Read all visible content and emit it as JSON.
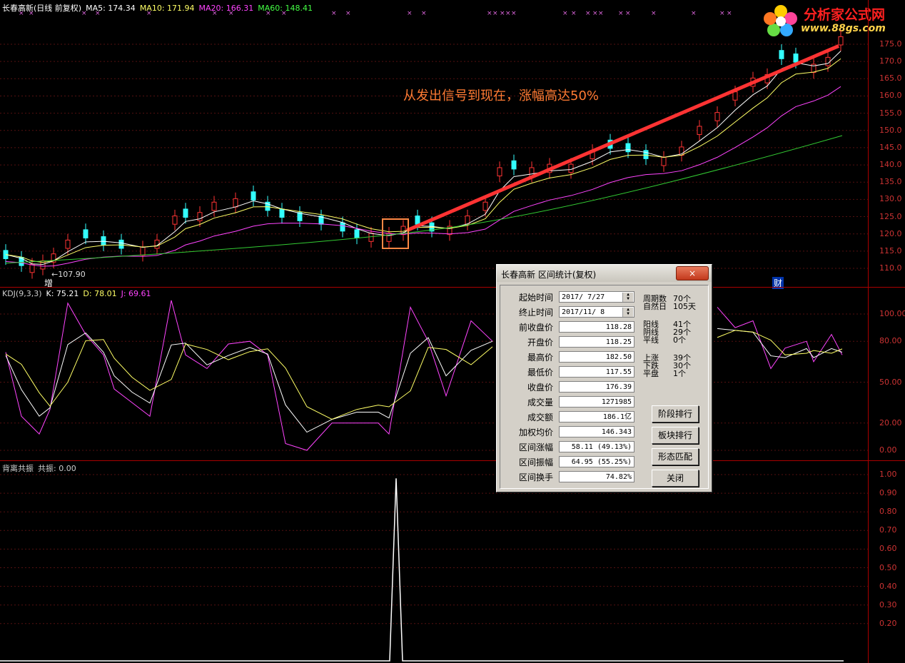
{
  "main": {
    "title": "长春高新(日线 前复权)",
    "ma": [
      {
        "label": "MA5: 174.34",
        "color": "#ffffff"
      },
      {
        "label": "MA10: 171.94",
        "color": "#ffff66"
      },
      {
        "label": "MA20: 166.31",
        "color": "#ff44ff"
      },
      {
        "label": "MA60: 148.41",
        "color": "#44ff44"
      }
    ],
    "annotation": "从发出信号到现在，涨幅高达50%",
    "low_label": "←107.90",
    "badge_zeng": "增",
    "badge_cai": "财",
    "y_ticks": [
      "175.0",
      "170.0",
      "165.0",
      "160.0",
      "155.0",
      "150.0",
      "145.0",
      "140.0",
      "135.0",
      "130.0",
      "125.0",
      "120.0",
      "115.0",
      "110.0"
    ],
    "y_tick_values": [
      175,
      170,
      165,
      160,
      155,
      150,
      145,
      140,
      135,
      130,
      125,
      120,
      115,
      110
    ],
    "x_marks": "×",
    "x_mark_groups": [
      "× ×",
      "× ×",
      "×",
      "× ×",
      "× ×",
      "× × × × ×",
      "× ×",
      "× × ×",
      "× ×",
      "×",
      "×",
      "× ×"
    ]
  },
  "kdj": {
    "title": "KDJ(9,3,3)",
    "k": "K: 75.21",
    "d": "D: 78.01",
    "j": "J: 69.61",
    "colors": {
      "k": "#ffffff",
      "d": "#ffff66",
      "j": "#ff44ff"
    },
    "y_ticks": [
      "100.00",
      "80.00",
      "50.00",
      "20.00",
      "0.00"
    ],
    "y_tick_values": [
      100,
      80,
      50,
      20,
      0
    ]
  },
  "resonance": {
    "title": "背离共振",
    "value": "共振: 0.00",
    "y_ticks": [
      "1.00",
      "0.90",
      "0.80",
      "0.70",
      "0.60",
      "0.50",
      "0.40",
      "0.30",
      "0.20"
    ],
    "y_tick_values": [
      1.0,
      0.9,
      0.8,
      0.7,
      0.6,
      0.5,
      0.4,
      0.3,
      0.2
    ]
  },
  "logo": {
    "name": "分析家公式网",
    "url": "www.88gs.com"
  },
  "dialog": {
    "title": "长春高新 区间统计(复权)",
    "close_label": "×",
    "fields": [
      {
        "label": "起始时间",
        "value": "2017/ 7/27",
        "kind": "date"
      },
      {
        "label": "终止时间",
        "value": "2017/11/ 8",
        "kind": "date"
      },
      {
        "label": "前收盘价",
        "value": "118.28"
      },
      {
        "label": "开盘价",
        "value": "118.25"
      },
      {
        "label": "最高价",
        "value": "182.50"
      },
      {
        "label": "最低价",
        "value": "117.55"
      },
      {
        "label": "收盘价",
        "value": "176.39"
      },
      {
        "label": "成交量",
        "value": "1271985"
      },
      {
        "label": "成交额",
        "value": "186.1亿"
      },
      {
        "label": "加权均价",
        "value": "146.343"
      },
      {
        "label": "区间涨幅",
        "value": "58.11 (49.13%)"
      },
      {
        "label": "区间振幅",
        "value": "64.95 (55.25%)"
      },
      {
        "label": "区间换手",
        "value": "74.82%"
      }
    ],
    "stats": [
      {
        "label": "周期数",
        "value": "70个"
      },
      {
        "label": "自然日",
        "value": "105天"
      },
      {
        "label": "阳线",
        "value": "41个"
      },
      {
        "label": "阴线",
        "value": "29个"
      },
      {
        "label": "平线",
        "value": "0个"
      },
      {
        "label": "上涨",
        "value": "39个"
      },
      {
        "label": "下跌",
        "value": "30个"
      },
      {
        "label": "平盘",
        "value": "1个"
      }
    ],
    "buttons": [
      "阶段排行",
      "板块排行",
      "形态匹配",
      "关闭"
    ]
  }
}
